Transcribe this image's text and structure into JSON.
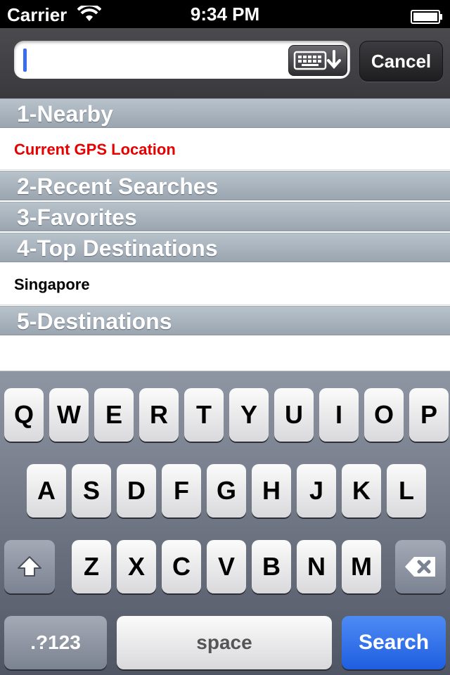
{
  "status_bar": {
    "carrier": "Carrier",
    "time": "9:34 PM"
  },
  "search": {
    "value": "",
    "placeholder": "",
    "cancel_label": "Cancel",
    "keyboard_toggle_icon": "keyboard-dismiss-icon"
  },
  "sections": [
    {
      "header": "1-Nearby",
      "rows": [
        {
          "label": "Current GPS Location",
          "color": "#e60000"
        }
      ]
    },
    {
      "header": "2-Recent Searches",
      "rows": []
    },
    {
      "header": "3-Favorites",
      "rows": []
    },
    {
      "header": "4-Top Destinations",
      "rows": [
        {
          "label": "Singapore"
        }
      ]
    },
    {
      "header": "5-Destinations",
      "rows": []
    }
  ],
  "keyboard": {
    "row1": [
      "Q",
      "W",
      "E",
      "R",
      "T",
      "Y",
      "U",
      "I",
      "O",
      "P"
    ],
    "row2": [
      "A",
      "S",
      "D",
      "F",
      "G",
      "H",
      "J",
      "K",
      "L"
    ],
    "row3": [
      "Z",
      "X",
      "C",
      "V",
      "B",
      "N",
      "M"
    ],
    "shift_icon": "shift-icon",
    "backspace_icon": "backspace-icon",
    "numbers_label": ".?123",
    "space_label": "space",
    "search_label": "Search"
  }
}
